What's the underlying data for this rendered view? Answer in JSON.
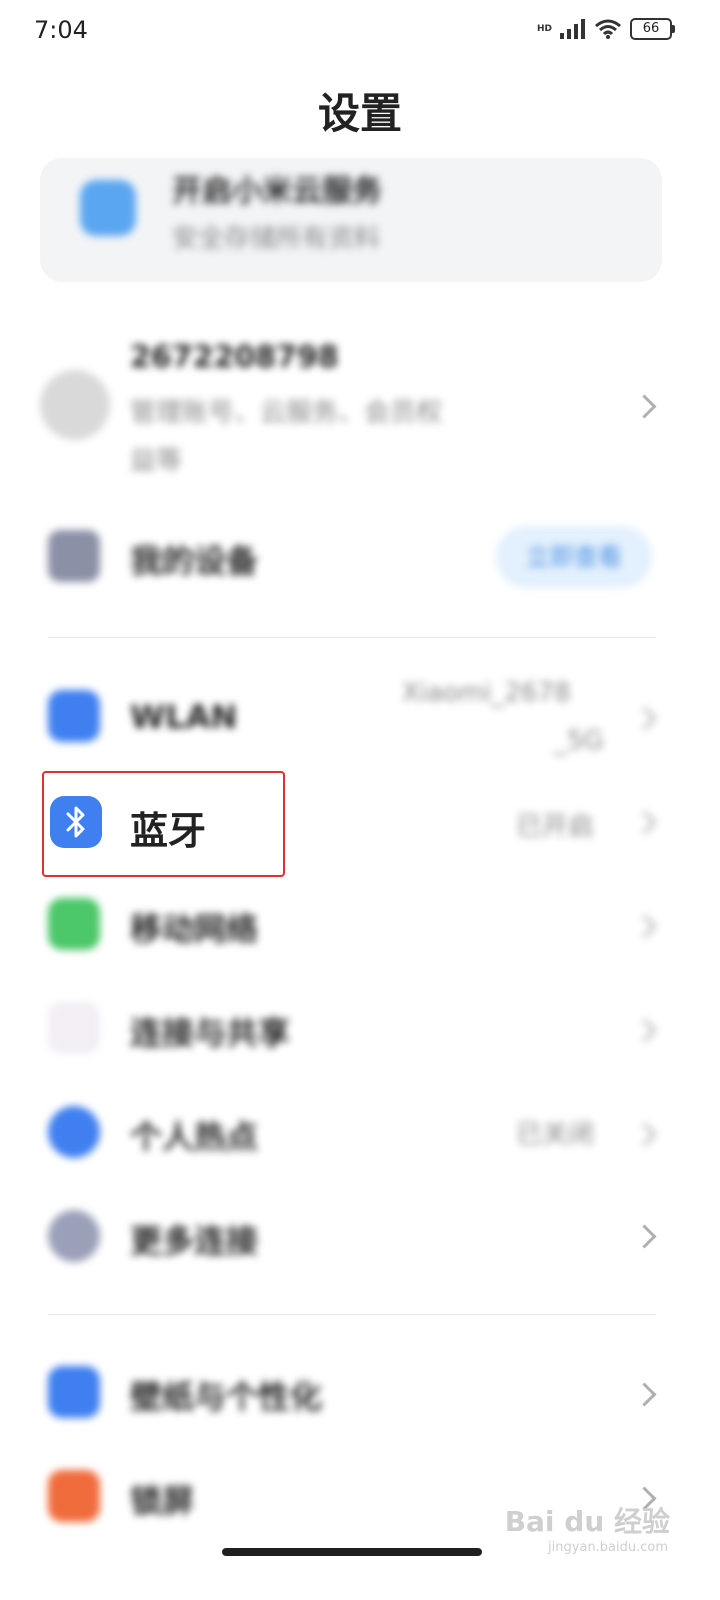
{
  "status_bar": {
    "time": "7:04",
    "network": "HD",
    "battery": "66"
  },
  "header": {
    "title": "设置"
  },
  "cloud_card": {
    "title": "开启小米云服务",
    "subtitle": "安全存储所有资料"
  },
  "account": {
    "id": "2672208798",
    "subtitle_line1": "管理账号、云服务、会员权",
    "subtitle_line2": "益等"
  },
  "my_device": {
    "label": "我的设备",
    "badge": "立即查看"
  },
  "rows": {
    "wlan": {
      "label": "WLAN",
      "value_line1": "Xiaomi_2678",
      "value_line2": "_5G"
    },
    "bluetooth": {
      "label": "蓝牙",
      "value": "已开启"
    },
    "mobile_network": {
      "label": "移动网络"
    },
    "connection_sharing": {
      "label": "连接与共享"
    },
    "hotspot": {
      "label": "个人热点",
      "value": "已关闭"
    },
    "more_connections": {
      "label": "更多连接"
    },
    "personalization": {
      "label": "壁纸与个性化"
    },
    "lock_screen": {
      "label": "锁屏"
    }
  },
  "watermark": {
    "brand": "Bai du 经验",
    "url": "jingyan.baidu.com"
  },
  "colors": {
    "accent_blue": "#3f7ff0",
    "highlight_red": "#e23030",
    "green": "#4cc769",
    "orange": "#f06b3c"
  }
}
